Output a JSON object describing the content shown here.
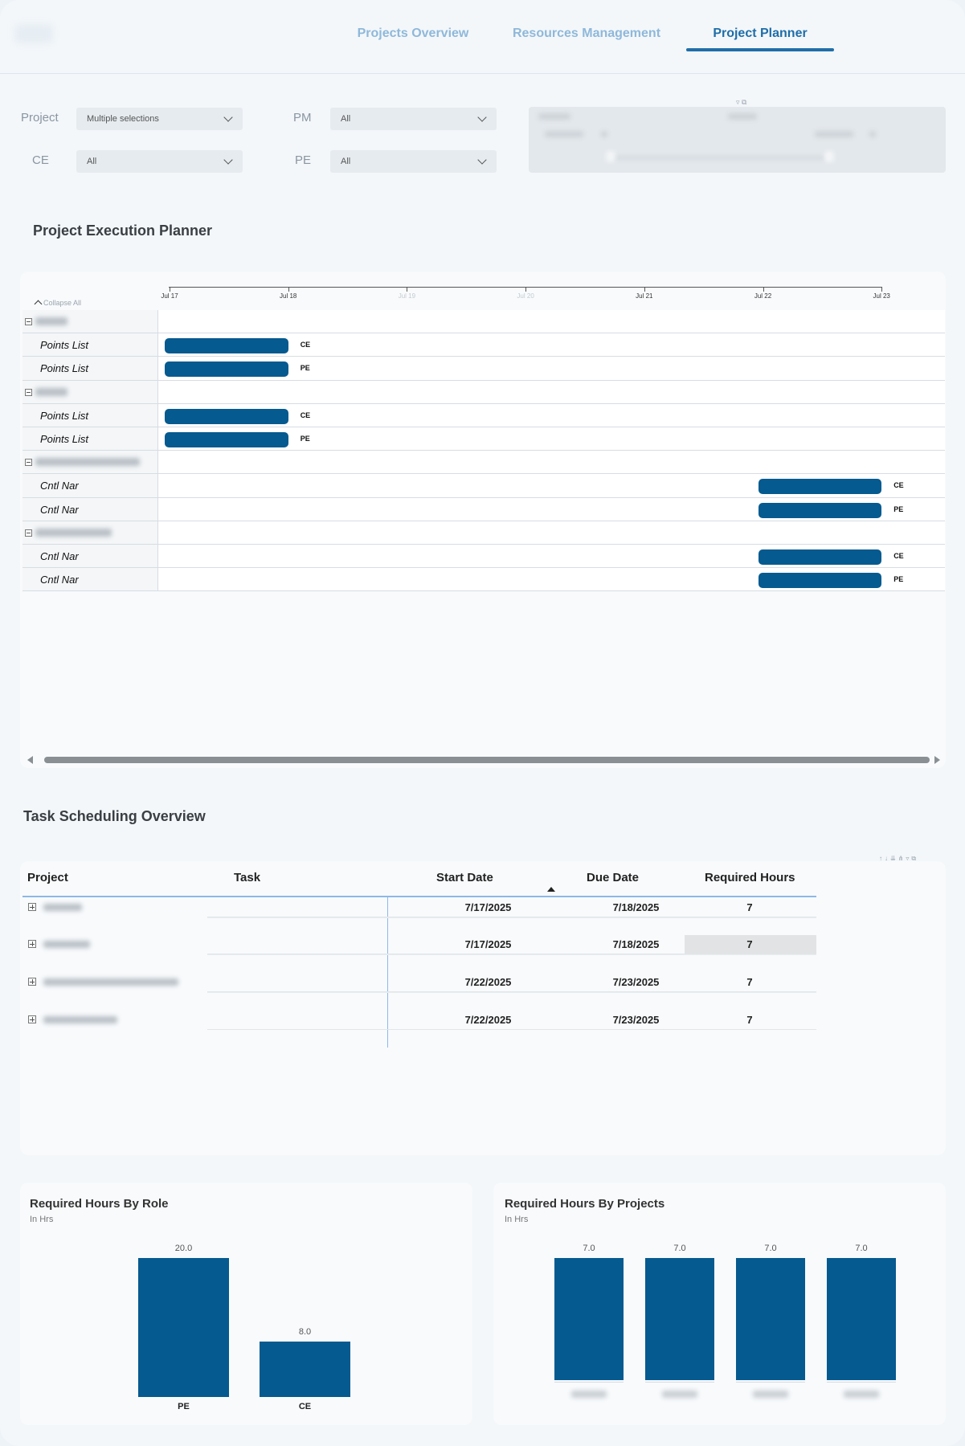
{
  "nav": {
    "tabs": [
      {
        "label": "Projects Overview"
      },
      {
        "label": "Resources Management"
      },
      {
        "label": "Project Planner"
      }
    ]
  },
  "filters": {
    "project": {
      "label": "Project",
      "value": "Multiple selections"
    },
    "pm": {
      "label": "PM",
      "value": "All"
    },
    "ce": {
      "label": "CE",
      "value": "All"
    },
    "pe": {
      "label": "PE",
      "value": "All"
    }
  },
  "planner": {
    "title": "Project Execution Planner",
    "collapse_label": "Collapse All",
    "axis_labels": [
      "Jul 17",
      "Jul 18",
      "Jul 19",
      "Jul 20",
      "Jul 21",
      "Jul 22",
      "Jul 23"
    ],
    "rows": [
      {
        "type": "group"
      },
      {
        "type": "task",
        "label": "Points List",
        "role": "CE",
        "start": "Jul 17",
        "end": "Jul 18"
      },
      {
        "type": "task",
        "label": "Points List",
        "role": "PE",
        "start": "Jul 17",
        "end": "Jul 18"
      },
      {
        "type": "group"
      },
      {
        "type": "task",
        "label": "Points List",
        "role": "CE",
        "start": "Jul 17",
        "end": "Jul 18"
      },
      {
        "type": "task",
        "label": "Points List",
        "role": "PE",
        "start": "Jul 17",
        "end": "Jul 18"
      },
      {
        "type": "group"
      },
      {
        "type": "task",
        "label": "Cntl Nar",
        "role": "CE",
        "start": "Jul 22",
        "end": "Jul 23"
      },
      {
        "type": "task",
        "label": "Cntl Nar",
        "role": "PE",
        "start": "Jul 22",
        "end": "Jul 23"
      },
      {
        "type": "group"
      },
      {
        "type": "task",
        "label": "Cntl Nar",
        "role": "CE",
        "start": "Jul 22",
        "end": "Jul 23"
      },
      {
        "type": "task",
        "label": "Cntl Nar",
        "role": "PE",
        "start": "Jul 22",
        "end": "Jul 23"
      }
    ]
  },
  "tasks_table": {
    "title": "Task Scheduling Overview",
    "columns": [
      "Project",
      "Task",
      "Start Date",
      "Due Date",
      "Required Hours"
    ],
    "rows": [
      {
        "start": "7/17/2025",
        "due": "7/18/2025",
        "hours": "7"
      },
      {
        "start": "7/17/2025",
        "due": "7/18/2025",
        "hours": "7"
      },
      {
        "start": "7/22/2025",
        "due": "7/23/2025",
        "hours": "7"
      },
      {
        "start": "7/22/2025",
        "due": "7/23/2025",
        "hours": "7"
      }
    ]
  },
  "role_chart": {
    "title": "Required Hours By Role",
    "subtitle": "In Hrs",
    "chart_data": {
      "type": "bar",
      "categories": [
        "PE",
        "CE"
      ],
      "values": [
        20.0,
        8.0
      ],
      "value_labels": [
        "20.0",
        "8.0"
      ],
      "ylim": [
        0,
        20
      ]
    }
  },
  "project_chart": {
    "title": "Required Hours By Projects",
    "subtitle": "In Hrs",
    "chart_data": {
      "type": "bar",
      "values": [
        7.0,
        7.0,
        7.0,
        7.0
      ],
      "value_labels": [
        "7.0",
        "7.0",
        "7.0",
        "7.0"
      ],
      "ylim": [
        0,
        7
      ]
    }
  },
  "colors": {
    "accent": "#1f6ea8",
    "bar": "#055a8f",
    "tab_inactive": "#8fb8d9"
  }
}
